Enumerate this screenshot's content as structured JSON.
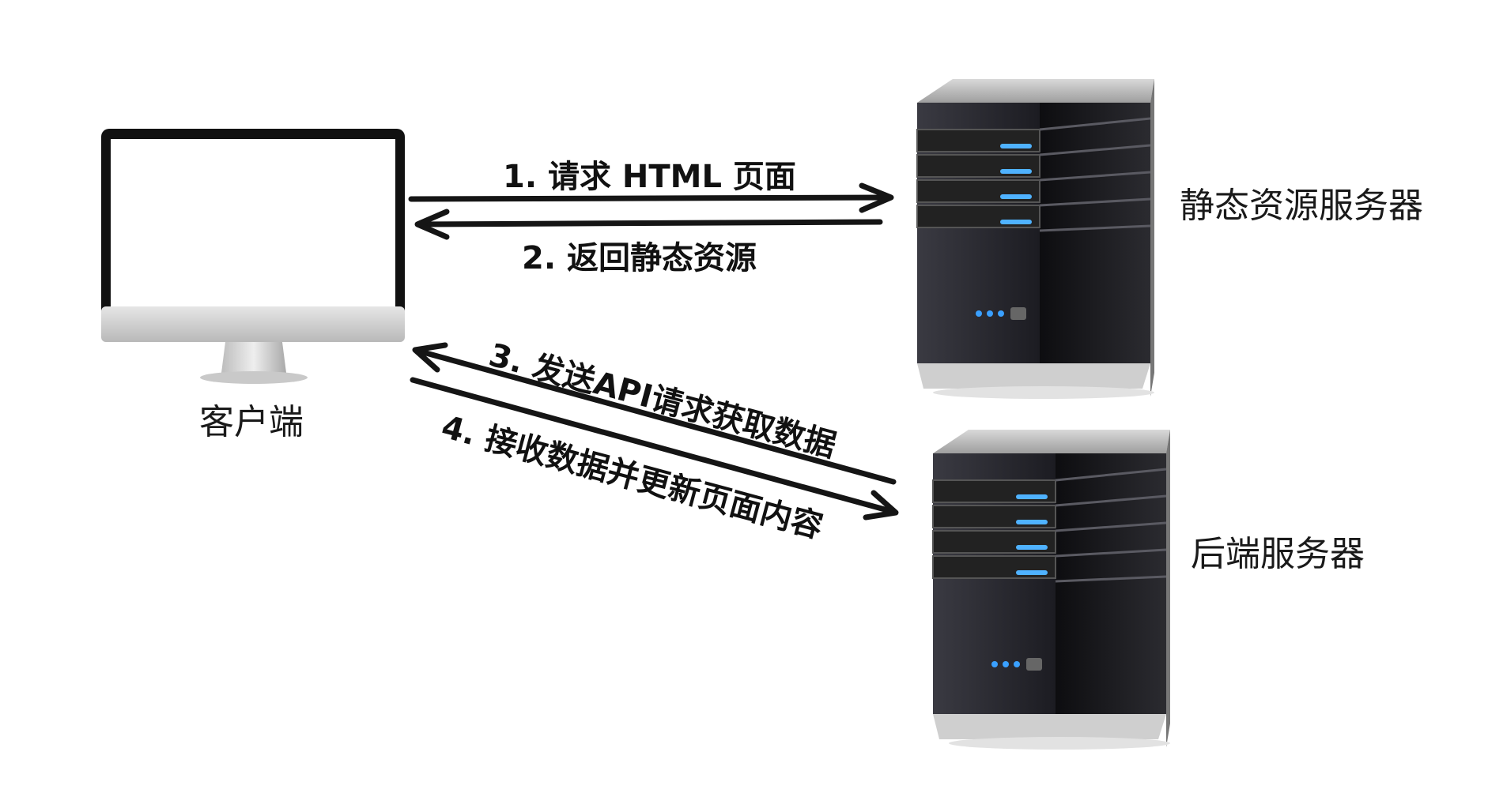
{
  "nodes": {
    "client": {
      "label": "客户端"
    },
    "static_server": {
      "label": "静态资源服务器"
    },
    "backend_server": {
      "label": "后端服务器"
    }
  },
  "steps": [
    {
      "label": "1. 请求 HTML 页面",
      "from": "client",
      "to": "static_server"
    },
    {
      "label": "2. 返回静态资源",
      "from": "static_server",
      "to": "client"
    },
    {
      "label": "3. 发送API请求获取数据",
      "from": "backend_server",
      "to": "client"
    },
    {
      "label": "4. 接收数据并更新页面内容",
      "from": "client",
      "to": "backend_server"
    }
  ],
  "colors": {
    "arrow": "#151515",
    "server_led": "#3aa0ff",
    "monitor_bezel": "#111111",
    "monitor_chin": "#cfcfcf"
  }
}
